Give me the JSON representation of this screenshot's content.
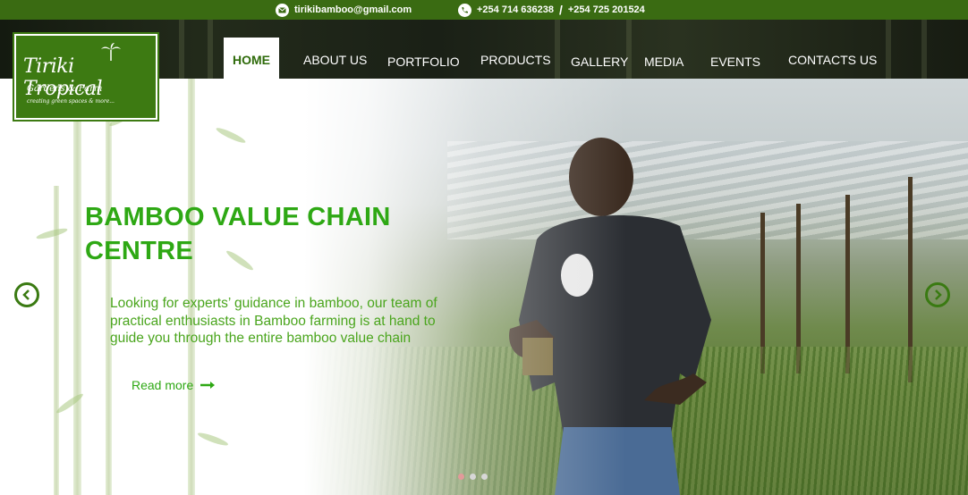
{
  "topbar": {
    "email": "tirikibamboo@gmail.com",
    "phone_1": "+254 714 636238",
    "separator": "/",
    "phone_2": "+254 725 201524",
    "email_icon": "envelope-icon",
    "phone_icon": "phone-icon"
  },
  "logo": {
    "name": "Tiriki Tropical",
    "subtitle": "Gardens & Farm",
    "tagline": "creating green spaces & more..."
  },
  "nav": {
    "items": [
      {
        "label": "HOME",
        "active": true
      },
      {
        "label": "ABOUT US"
      },
      {
        "label": "PORTFOLIO"
      },
      {
        "label": "PRODUCTS"
      },
      {
        "label": "GALLERY"
      },
      {
        "label": "MEDIA"
      },
      {
        "label": "EVENTS"
      },
      {
        "label": "CONTACTS US"
      }
    ]
  },
  "hero": {
    "title": "BAMBOO VALUE CHAIN CENTRE",
    "description": "Looking for experts’ guidance in bamboo, our team of practical enthusiasts in Bamboo farming is at hand to guide you through the entire bamboo value chain",
    "read_more": "Read more",
    "slides_total": 3,
    "active_slide": 1
  },
  "colors": {
    "topbar": "#3a6b12",
    "brand_green": "#2ea814",
    "logo_bg": "#3d7a12"
  }
}
